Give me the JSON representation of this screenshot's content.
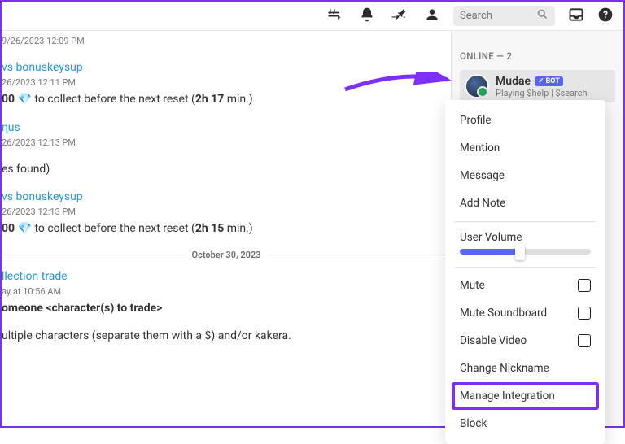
{
  "topbar": {
    "search_placeholder": "Search",
    "inbox_label": "Inbox",
    "help_label": "Help"
  },
  "chat": {
    "b1": {
      "ts": "9/26/2023 12:09 PM"
    },
    "b2": {
      "link": "vs bonuskeysup",
      "ts": "26/2023 12:11 PM",
      "text_pre": "00 ",
      "text_mid": " to collect before the next reset (",
      "text_bold": "2h 17",
      "text_post": " min.)"
    },
    "b3": {
      "link": "ɳus",
      "ts": "26/2023 12:13 PM"
    },
    "b4": {
      "text": "es found)"
    },
    "b5": {
      "link": "vs bonuskeysup",
      "ts": "26/2023 12:13 PM",
      "text_pre": "00 ",
      "text_mid": " to collect before the next reset (",
      "text_bold": "2h 15",
      "text_post": " min.)"
    },
    "divider": "October 30, 2023",
    "b6": {
      "link": "llection trade",
      "ts": "ay at 10:56 AM",
      "bold": "omeone <character(s) to trade>"
    },
    "b7": "ultiple characters (separate them with a $) and/or kakera."
  },
  "sidebar": {
    "heading": "ONLINE — 2",
    "user": {
      "name": "Mudae",
      "bot_badge": "BOT",
      "status": "Playing $help | $search"
    }
  },
  "menu": {
    "profile": "Profile",
    "mention": "Mention",
    "message": "Message",
    "add_note": "Add Note",
    "user_volume": "User Volume",
    "mute": "Mute",
    "mute_soundboard": "Mute Soundboard",
    "disable_video": "Disable Video",
    "change_nickname": "Change Nickname",
    "manage_integration": "Manage Integration",
    "block": "Block"
  }
}
